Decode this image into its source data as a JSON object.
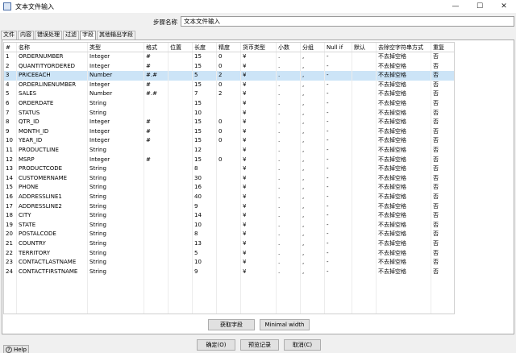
{
  "window": {
    "title": "文本文件输入",
    "controls": [
      "—",
      "☐",
      "✕"
    ]
  },
  "step_name": {
    "label": "步骤名称",
    "value": "文本文件输入"
  },
  "tabs": [
    {
      "label": "文件",
      "active": false
    },
    {
      "label": "内容",
      "active": false
    },
    {
      "label": "错误处理",
      "active": false
    },
    {
      "label": "过滤",
      "active": false
    },
    {
      "label": "字段",
      "active": true
    },
    {
      "label": "其他输出字段",
      "active": false
    }
  ],
  "table": {
    "headers": [
      "#",
      "名称",
      "类型",
      "格式",
      "位置",
      "长度",
      "精度",
      "货币类型",
      "小数",
      "分组",
      "Null if",
      "默认",
      "去除空字符串方式",
      "重复"
    ],
    "rows": [
      [
        "1",
        "ORDERNUMBER",
        "Integer",
        "#",
        "",
        "15",
        "0",
        "¥",
        ".",
        ",",
        "-",
        "",
        "不去掉空格",
        "否"
      ],
      [
        "2",
        "QUANTITYORDERED",
        "Integer",
        "#",
        "",
        "15",
        "0",
        "¥",
        ".",
        ",",
        "-",
        "",
        "不去掉空格",
        "否"
      ],
      [
        "3",
        "PRICEEACH",
        "Number",
        "#.#",
        "",
        "5",
        "2",
        "¥",
        ".",
        ",",
        "-",
        "",
        "不去掉空格",
        "否"
      ],
      [
        "4",
        "ORDERLINENUMBER",
        "Integer",
        "#",
        "",
        "15",
        "0",
        "¥",
        ".",
        ",",
        "-",
        "",
        "不去掉空格",
        "否"
      ],
      [
        "5",
        "SALES",
        "Number",
        "#.#",
        "",
        "7",
        "2",
        "¥",
        ".",
        ",",
        "-",
        "",
        "不去掉空格",
        "否"
      ],
      [
        "6",
        "ORDERDATE",
        "String",
        "",
        "",
        "15",
        "",
        "¥",
        ".",
        ",",
        "-",
        "",
        "不去掉空格",
        "否"
      ],
      [
        "7",
        "STATUS",
        "String",
        "",
        "",
        "10",
        "",
        "¥",
        ".",
        ",",
        "-",
        "",
        "不去掉空格",
        "否"
      ],
      [
        "8",
        "QTR_ID",
        "Integer",
        "#",
        "",
        "15",
        "0",
        "¥",
        ".",
        ",",
        "-",
        "",
        "不去掉空格",
        "否"
      ],
      [
        "9",
        "MONTH_ID",
        "Integer",
        "#",
        "",
        "15",
        "0",
        "¥",
        ".",
        ",",
        "-",
        "",
        "不去掉空格",
        "否"
      ],
      [
        "10",
        "YEAR_ID",
        "Integer",
        "#",
        "",
        "15",
        "0",
        "¥",
        ".",
        ",",
        "-",
        "",
        "不去掉空格",
        "否"
      ],
      [
        "11",
        "PRODUCTLINE",
        "String",
        "",
        "",
        "12",
        "",
        "¥",
        ".",
        ",",
        "-",
        "",
        "不去掉空格",
        "否"
      ],
      [
        "12",
        "MSRP",
        "Integer",
        "#",
        "",
        "15",
        "0",
        "¥",
        ".",
        ",",
        "-",
        "",
        "不去掉空格",
        "否"
      ],
      [
        "13",
        "PRODUCTCODE",
        "String",
        "",
        "",
        "8",
        "",
        "¥",
        ".",
        ",",
        "-",
        "",
        "不去掉空格",
        "否"
      ],
      [
        "14",
        "CUSTOMERNAME",
        "String",
        "",
        "",
        "30",
        "",
        "¥",
        ".",
        ",",
        "-",
        "",
        "不去掉空格",
        "否"
      ],
      [
        "15",
        "PHONE",
        "String",
        "",
        "",
        "16",
        "",
        "¥",
        ".",
        ",",
        "-",
        "",
        "不去掉空格",
        "否"
      ],
      [
        "16",
        "ADDRESSLINE1",
        "String",
        "",
        "",
        "40",
        "",
        "¥",
        ".",
        ",",
        "-",
        "",
        "不去掉空格",
        "否"
      ],
      [
        "17",
        "ADDRESSLINE2",
        "String",
        "",
        "",
        "9",
        "",
        "¥",
        ".",
        ",",
        "-",
        "",
        "不去掉空格",
        "否"
      ],
      [
        "18",
        "CITY",
        "String",
        "",
        "",
        "14",
        "",
        "¥",
        ".",
        ",",
        "-",
        "",
        "不去掉空格",
        "否"
      ],
      [
        "19",
        "STATE",
        "String",
        "",
        "",
        "10",
        "",
        "¥",
        ".",
        ",",
        "-",
        "",
        "不去掉空格",
        "否"
      ],
      [
        "20",
        "POSTALCODE",
        "String",
        "",
        "",
        "8",
        "",
        "¥",
        ".",
        ",",
        "-",
        "",
        "不去掉空格",
        "否"
      ],
      [
        "21",
        "COUNTRY",
        "String",
        "",
        "",
        "13",
        "",
        "¥",
        ".",
        ",",
        "-",
        "",
        "不去掉空格",
        "否"
      ],
      [
        "22",
        "TERRITORY",
        "String",
        "",
        "",
        "5",
        "",
        "¥",
        ".",
        ",",
        "-",
        "",
        "不去掉空格",
        "否"
      ],
      [
        "23",
        "CONTACTLASTNAME",
        "String",
        "",
        "",
        "10",
        "",
        "¥",
        ".",
        ",",
        "-",
        "",
        "不去掉空格",
        "否"
      ],
      [
        "24",
        "CONTACTFIRSTNAME",
        "String",
        "",
        "",
        "9",
        "",
        "¥",
        ".",
        ",",
        "-",
        "",
        "不去掉空格",
        "否"
      ]
    ],
    "selected_row": 2
  },
  "buttons": {
    "get_fields": "获取字段",
    "minimal_width": "Minimal width",
    "ok": "确定(O)",
    "preview": "预览记录",
    "cancel": "取消(C)",
    "help": "Help"
  },
  "colors": {
    "selection": "#cce4f7",
    "window_bg": "#f0f0f0"
  }
}
